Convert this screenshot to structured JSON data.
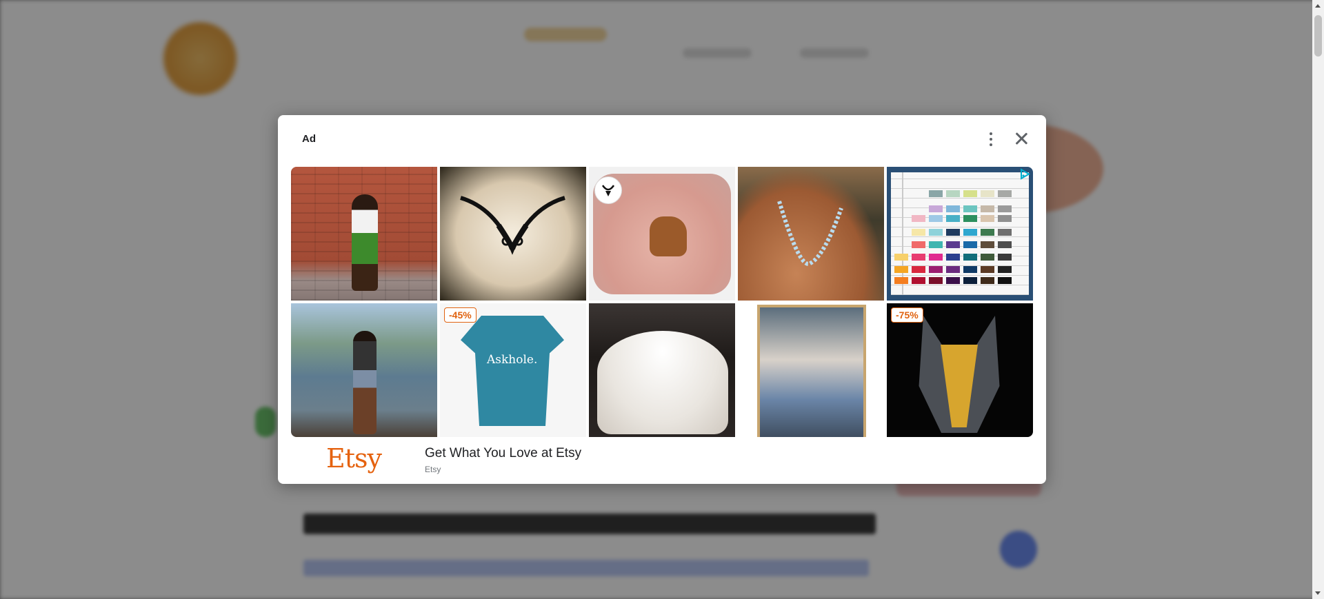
{
  "modal": {
    "ad_label": "Ad",
    "menu_icon": "more-vert-icon",
    "close_icon": "close-icon",
    "adchoices_icon": "adchoices-icon",
    "tiles": [
      {
        "alt": "woman-in-green-print-skirt",
        "badge": ""
      },
      {
        "alt": "black-lace-v-necklace",
        "badge": ""
      },
      {
        "alt": "capybara-earring",
        "badge": ""
      },
      {
        "alt": "blue-bead-necklace",
        "badge": ""
      },
      {
        "alt": "thread-color-chart",
        "badge": ""
      },
      {
        "alt": "woman-on-lake-shore",
        "badge": ""
      },
      {
        "alt": "askhole-t-shirt",
        "badge": "-45%",
        "shirt_text": "Askhole."
      },
      {
        "alt": "white-wedding-gown",
        "badge": ""
      },
      {
        "alt": "framed-photo-poster",
        "badge": ""
      },
      {
        "alt": "wolverine-helmet",
        "badge": "-75%"
      }
    ],
    "brand_logo": "Etsy",
    "title": "Get What You Love at Etsy",
    "source": "Etsy"
  },
  "colors": {
    "etsy_orange": "#e5620f",
    "badge_orange": "#e0620f",
    "adchoices_blue": "#00aecd"
  }
}
